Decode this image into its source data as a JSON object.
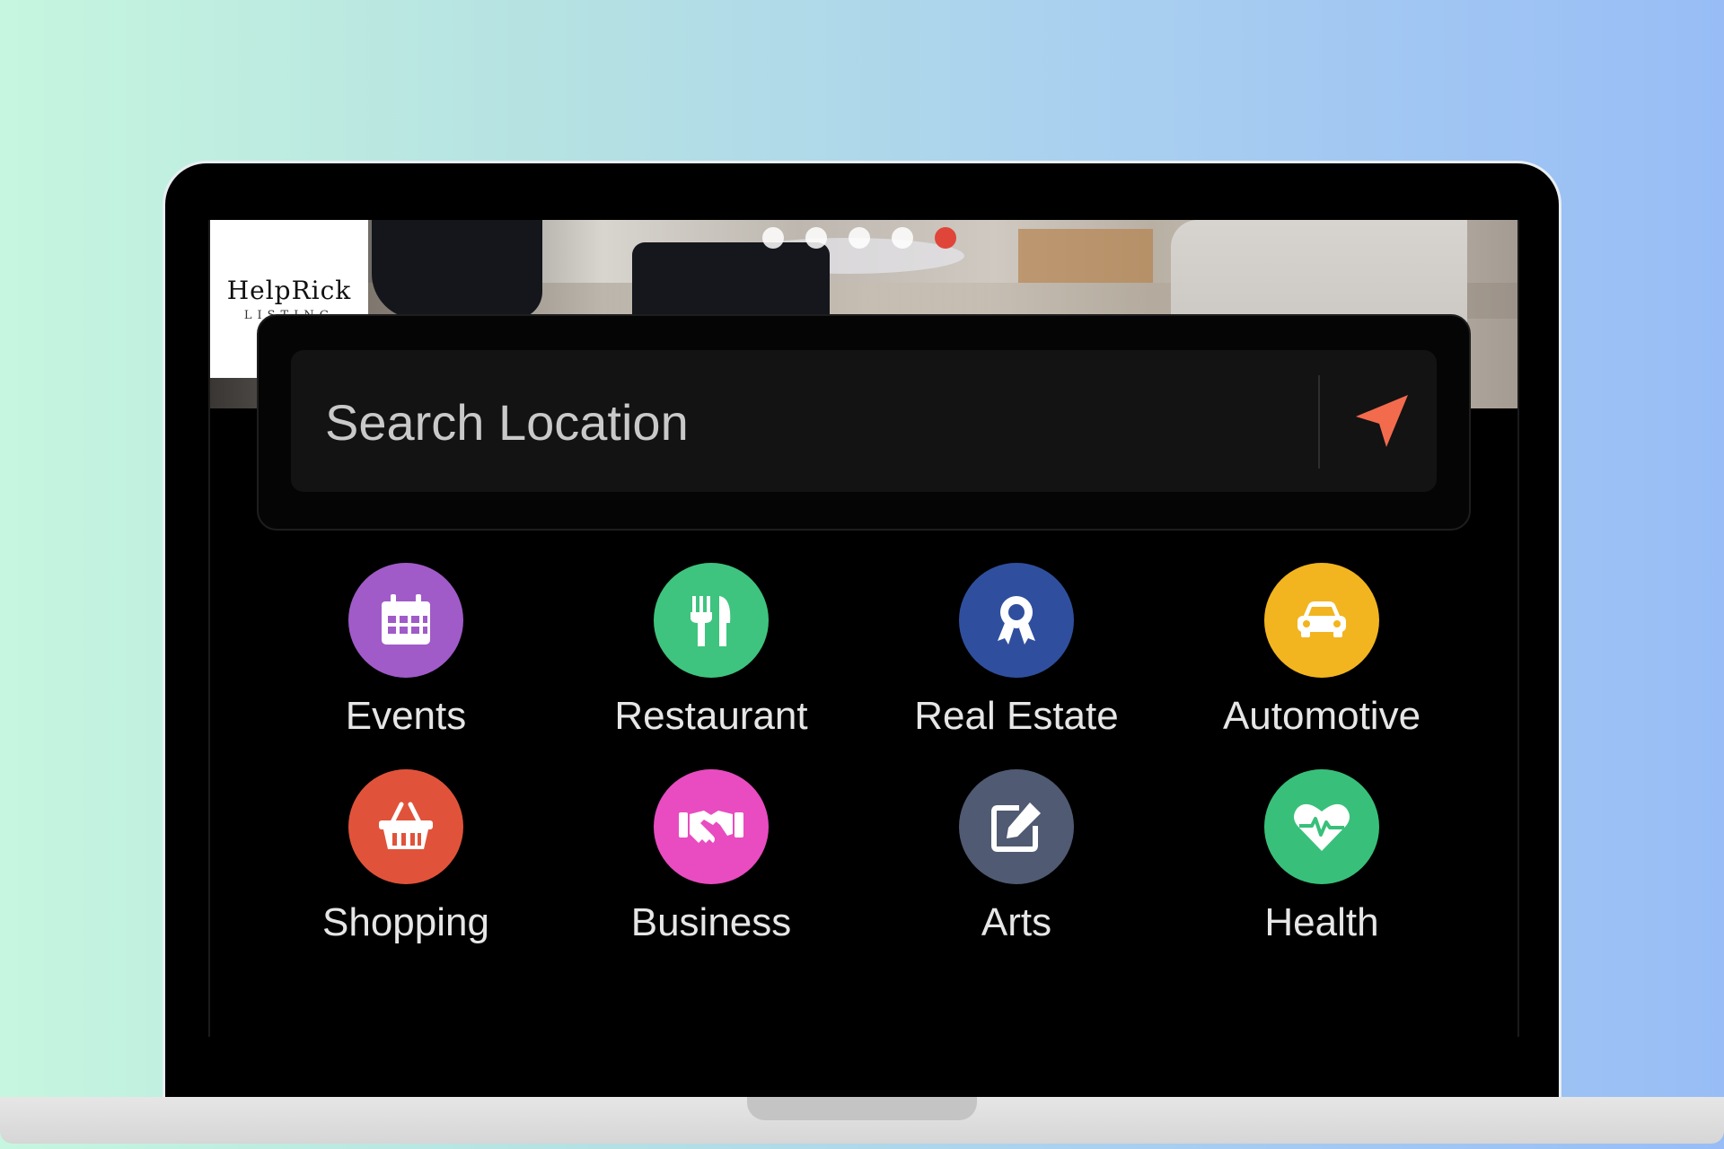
{
  "logo": {
    "brand": "HelpRick",
    "sub": "LISTING"
  },
  "carousel": {
    "dots": 5,
    "active_index": 4
  },
  "search": {
    "placeholder": "Search Location",
    "value": ""
  },
  "categories": [
    {
      "label": "Events",
      "icon": "calendar-icon",
      "color": "#a05bc8"
    },
    {
      "label": "Restaurant",
      "icon": "fork-knife-icon",
      "color": "#3ec47e"
    },
    {
      "label": "Real Estate",
      "icon": "award-ribbon-icon",
      "color": "#2f4f9e"
    },
    {
      "label": "Automotive",
      "icon": "car-icon",
      "color": "#f2b51f"
    },
    {
      "label": "Shopping",
      "icon": "basket-icon",
      "color": "#e0533a"
    },
    {
      "label": "Business",
      "icon": "handshake-icon",
      "color": "#e84cc0"
    },
    {
      "label": "Arts",
      "icon": "edit-icon",
      "color": "#505a72"
    },
    {
      "label": "Health",
      "icon": "heartbeat-icon",
      "color": "#38c07a"
    }
  ],
  "colors": {
    "accent": "#f36b4d"
  }
}
